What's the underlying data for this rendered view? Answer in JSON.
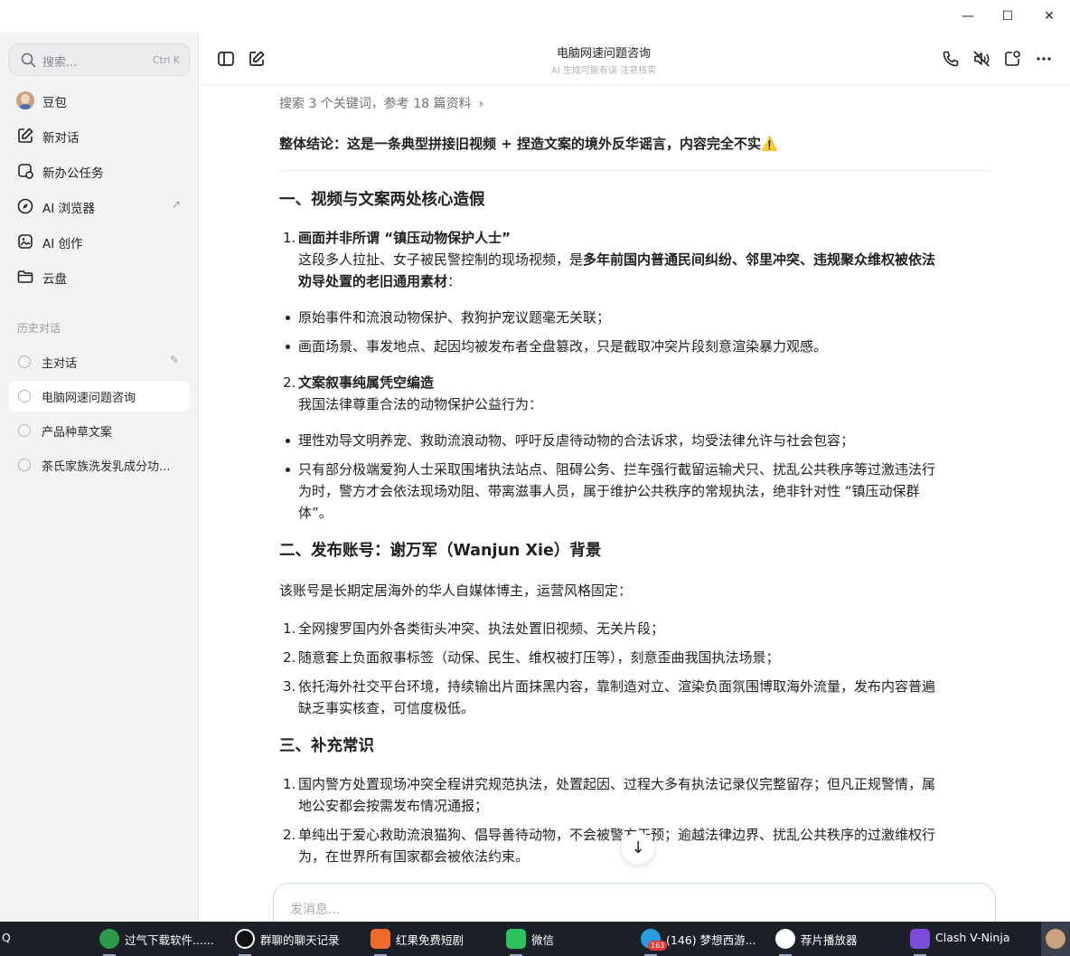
{
  "window": {
    "minimize_icon": "—",
    "maximize_icon": "☐",
    "close_icon": "✕"
  },
  "sidebar": {
    "search_placeholder": "搜索...",
    "search_shortcut": "Ctrl K",
    "nav": [
      {
        "label": "豆包",
        "icon": "avatar"
      },
      {
        "label": "新对话",
        "icon": "edit-icon"
      },
      {
        "label": "新办公任务",
        "icon": "task-icon"
      },
      {
        "label": "AI 浏览器",
        "icon": "compass-icon",
        "extra": "↗"
      },
      {
        "label": "AI 创作",
        "icon": "image-icon"
      },
      {
        "label": "云盘",
        "icon": "folder-icon"
      }
    ],
    "history_title": "历史对话",
    "history": [
      {
        "label": "主对话",
        "pinned": true
      },
      {
        "label": "电脑网速问题咨询",
        "active": true
      },
      {
        "label": "产品种草文案"
      },
      {
        "label": "茶氏家族洗发乳成分功..."
      }
    ]
  },
  "header": {
    "title": "电脑网速问题咨询",
    "subtitle": "AI 生成可能有误 注意核实"
  },
  "content": {
    "search_summary": "搜索 3 个关键词，参考 18 篇资料",
    "conclusion": "整体结论：这是一条典型拼接旧视频 + 捏造文案的境外反华谣言，内容完全不实⚠️",
    "section1_title": "一、视频与文案两处核心造假",
    "s1_item1_num": "1.",
    "s1_item1_title": "画面并非所谓 “镇压动物保护人士”",
    "s1_item1_l1a": "这段多人拉扯、女子被民警控制的现场视频，是",
    "s1_item1_l1b": "多年前国内普通民间纠纷、邻里冲突、违规聚众维权被依法",
    "s1_item1_l2a": "劝导处置的老旧通用素材",
    "s1_item1_l2b": "：",
    "s1_bullet1": "原始事件和流浪动物保护、救狗护宠议题毫无关联；",
    "s1_bullet2": "画面场景、事发地点、起因均被发布者全盘篡改，只是截取冲突片段刻意渲染暴力观感。",
    "s1_item2_num": "2.",
    "s1_item2_title": "文案叙事纯属凭空编造",
    "s1_item2_l1": "我国法律尊重合法的动物保护公益行为：",
    "s1_bullet3": "理性劝导文明养宠、救助流浪动物、呼吁反虐待动物的合法诉求，均受法律允许与社会包容；",
    "s1_bullet4_l1": "只有部分极端爱狗人士采取围堵执法站点、阻碍公务、拦车强行截留运输犬只、扰乱公共秩序等过激违法行",
    "s1_bullet4_l2": "为时，警方才会依法现场劝阻、带离滋事人员，属于维护公共秩序的常规执法，绝非针对性 “镇压动保群",
    "s1_bullet4_l3": "体”。",
    "section2_title": "二、发布账号：谢万军（Wanjun Xie）背景",
    "s2_intro": "该账号是长期定居海外的华人自媒体博主，运营风格固定：",
    "s2_item1": "全网搜罗国内外各类街头冲突、执法处置旧视频、无关片段；",
    "s2_item2": "随意套上负面叙事标签（动保、民生、维权被打压等），刻意歪曲我国执法场景；",
    "s2_item3_l1": "依托海外社交平台环境，持续输出片面抹黑内容，靠制造对立、渲染负面氛围博取海外流量，发布内容普遍",
    "s2_item3_l2": "缺乏事实核查，可信度极低。",
    "section3_title": "三、补充常识",
    "s3_item1_l1": "国内警方处置现场冲突全程讲究规范执法，处置起因、过程大多有执法记录仪完整留存；但凡正规警情，属",
    "s3_item1_l2": "地公安都会按需发布情况通报；",
    "s3_item2_l1": "单纯出于爱心救助流浪猫狗、倡导善待动物，不会被警方干预；逾越法律边界、扰乱公共秩序的过激维权行",
    "s3_item2_l2": "为，在世界所有国家都会被依法约束。",
    "n1": "1.",
    "n2": "2.",
    "n3": "3."
  },
  "composer": {
    "placeholder": "发消息..."
  },
  "taskbar": {
    "left_fragment": "Q",
    "items": [
      {
        "label": "过气下载软件......",
        "color": "#2f9a4a"
      },
      {
        "label": "群聊的聊天记录",
        "color": "#111111"
      },
      {
        "label": "红果免费短剧",
        "color": "#f06a2b"
      },
      {
        "label": "微信",
        "color": "#2dc15f"
      },
      {
        "label": "(146) 梦想西游...",
        "color": "#2a9ee0",
        "badge": "163"
      },
      {
        "label": "荐片播放器",
        "color": "#ffffff"
      },
      {
        "label": "Clash V-Ninja",
        "color": "#7b4cd9"
      }
    ]
  },
  "colors": {
    "sidebar_bg": "#f3f3f4",
    "active_item_bg": "#ffffff",
    "composer_border": "#c8d6f7",
    "taskbar_bg": "#1c2029",
    "warning": "#f5c518"
  }
}
